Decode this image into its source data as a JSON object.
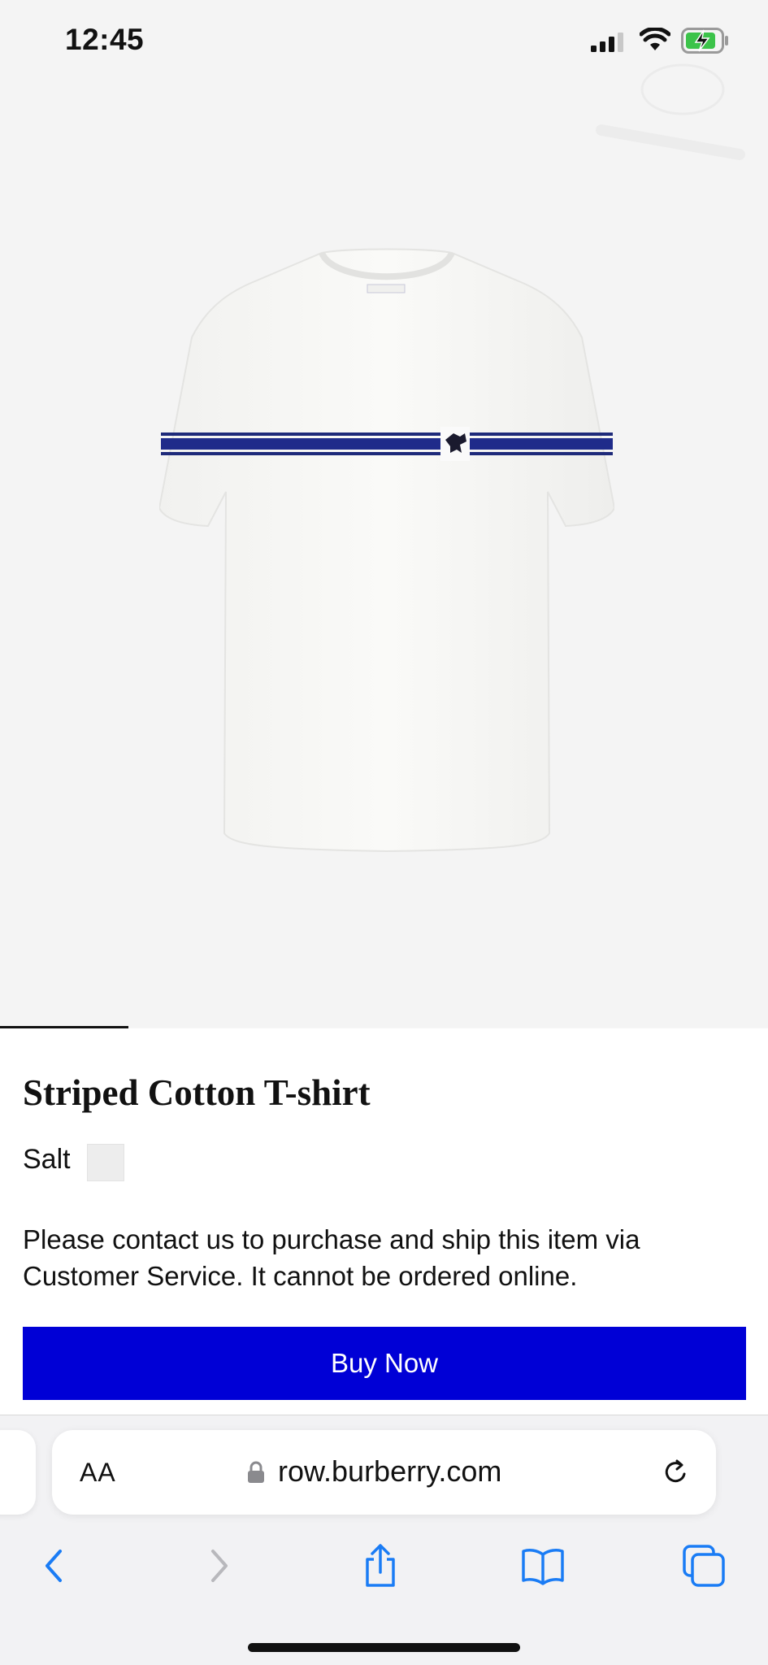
{
  "status_bar": {
    "time": "12:45"
  },
  "product": {
    "title": "Striped Cotton T-shirt",
    "color_label": "Salt",
    "swatch_color": "#ededed",
    "notice": "Please contact us to purchase and ship this item via Customer Service. It cannot be ordered online.",
    "buy_button_label": "Buy Now",
    "buy_button_color": "#0000d6"
  },
  "browser": {
    "text_size_label": "AA",
    "url": "row.burberry.com"
  },
  "icons": {
    "signal": "cellular-signal-icon",
    "wifi": "wifi-icon",
    "battery": "battery-charging-icon",
    "lock": "lock-icon",
    "reload": "reload-icon",
    "back": "back-chevron-icon",
    "forward": "forward-chevron-icon",
    "share": "share-icon",
    "bookmarks": "bookmarks-book-icon",
    "tabs": "tabs-icon"
  },
  "colors": {
    "accent": "#1a7cf5"
  }
}
